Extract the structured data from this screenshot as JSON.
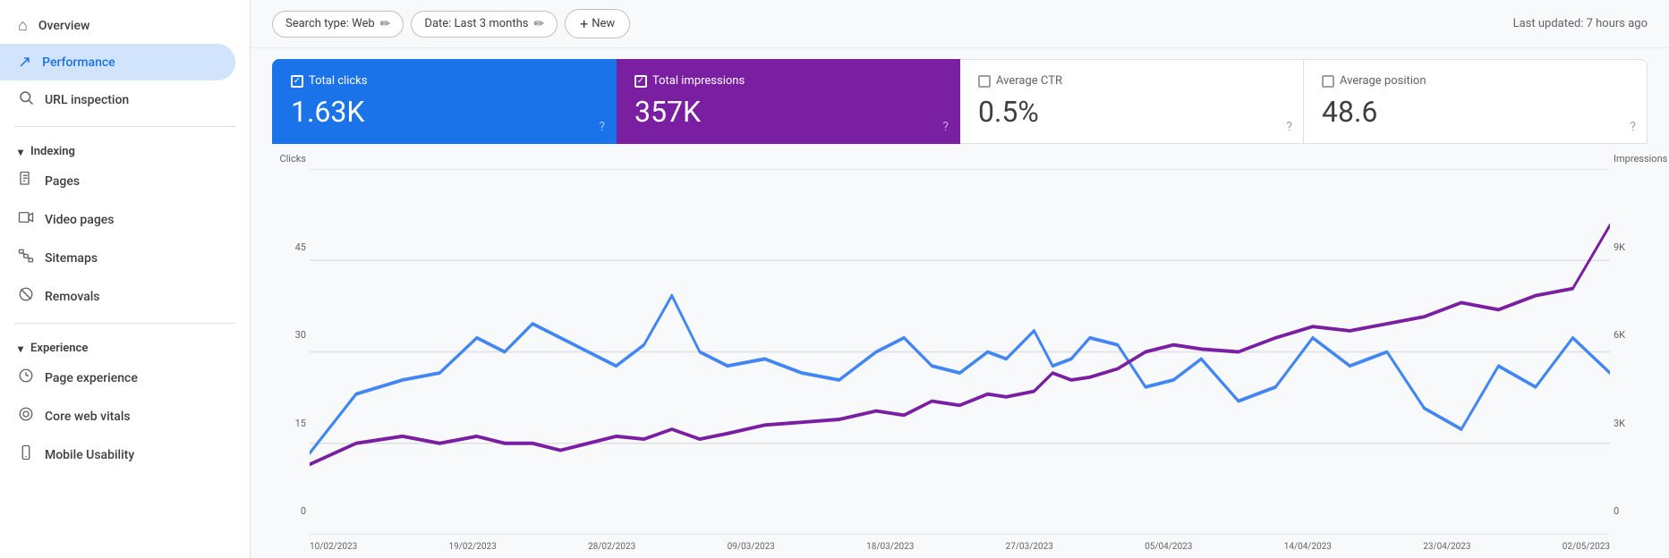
{
  "sidebar": {
    "items": [
      {
        "id": "overview",
        "label": "Overview",
        "icon": "⌂",
        "active": false
      },
      {
        "id": "performance",
        "label": "Performance",
        "icon": "↗",
        "active": true
      },
      {
        "id": "url-inspection",
        "label": "URL inspection",
        "icon": "🔍",
        "active": false
      }
    ],
    "sections": [
      {
        "id": "indexing",
        "label": "Indexing",
        "expanded": true,
        "items": [
          {
            "id": "pages",
            "label": "Pages",
            "icon": "📄"
          },
          {
            "id": "video-pages",
            "label": "Video pages",
            "icon": "🎬"
          },
          {
            "id": "sitemaps",
            "label": "Sitemaps",
            "icon": "🗂"
          },
          {
            "id": "removals",
            "label": "Removals",
            "icon": "🚫"
          }
        ]
      },
      {
        "id": "experience",
        "label": "Experience",
        "expanded": true,
        "items": [
          {
            "id": "page-experience",
            "label": "Page experience",
            "icon": "⊕"
          },
          {
            "id": "core-web-vitals",
            "label": "Core web vitals",
            "icon": "◎"
          },
          {
            "id": "mobile-usability",
            "label": "Mobile Usability",
            "icon": "📱"
          }
        ]
      }
    ]
  },
  "topbar": {
    "search_type_label": "Search type: Web",
    "date_label": "Date: Last 3 months",
    "new_label": "New",
    "last_updated": "Last updated: 7 hours ago"
  },
  "metrics": [
    {
      "id": "total-clicks",
      "title": "Total clicks",
      "value": "1.63K",
      "active": "blue",
      "checked": true
    },
    {
      "id": "total-impressions",
      "title": "Total impressions",
      "value": "357K",
      "active": "purple",
      "checked": true
    },
    {
      "id": "average-ctr",
      "title": "Average CTR",
      "value": "0.5%",
      "active": false,
      "checked": false
    },
    {
      "id": "average-position",
      "title": "Average position",
      "value": "48.6",
      "active": false,
      "checked": false
    }
  ],
  "chart": {
    "y_axis_left_label": "Clicks",
    "y_axis_left_max": "45",
    "y_axis_left_mid": "30",
    "y_axis_left_low": "15",
    "y_axis_left_zero": "0",
    "y_axis_right_label": "Impressions",
    "y_axis_right_max": "9K",
    "y_axis_right_mid": "6K",
    "y_axis_right_low": "3K",
    "y_axis_right_zero": "0",
    "x_labels": [
      "10/02/2023",
      "19/02/2023",
      "28/02/2023",
      "09/03/2023",
      "18/03/2023",
      "27/03/2023",
      "05/04/2023",
      "14/04/2023",
      "23/04/2023",
      "02/05/2023"
    ]
  }
}
